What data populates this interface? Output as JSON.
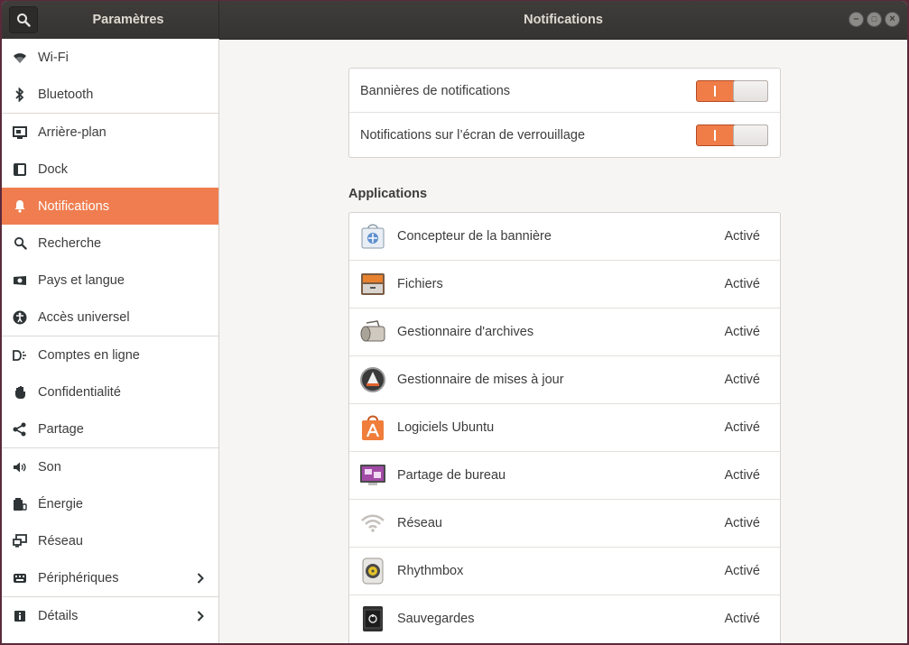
{
  "header": {
    "sidebar_title": "Paramètres",
    "title": "Notifications",
    "search_icon": "search-icon",
    "window_buttons": [
      "minimize",
      "maximize",
      "close"
    ]
  },
  "sidebar": {
    "items": [
      {
        "label": "Wi-Fi",
        "icon": "wifi-icon"
      },
      {
        "label": "Bluetooth",
        "icon": "bluetooth-icon"
      },
      {
        "label": "Arrière-plan",
        "icon": "background-icon"
      },
      {
        "label": "Dock",
        "icon": "dock-icon"
      },
      {
        "label": "Notifications",
        "icon": "bell-icon",
        "active": true
      },
      {
        "label": "Recherche",
        "icon": "search-icon"
      },
      {
        "label": "Pays et langue",
        "icon": "region-icon"
      },
      {
        "label": "Accès universel",
        "icon": "accessibility-icon"
      },
      {
        "label": "Comptes en ligne",
        "icon": "online-accounts-icon"
      },
      {
        "label": "Confidentialité",
        "icon": "privacy-hand-icon"
      },
      {
        "label": "Partage",
        "icon": "share-icon"
      },
      {
        "label": "Son",
        "icon": "speaker-icon"
      },
      {
        "label": "Énergie",
        "icon": "power-icon"
      },
      {
        "label": "Réseau",
        "icon": "network-icon"
      },
      {
        "label": "Périphériques",
        "icon": "devices-icon",
        "chevron": true
      },
      {
        "label": "Détails",
        "icon": "info-icon",
        "chevron": true
      }
    ]
  },
  "toggles": [
    {
      "label": "Bannières de notifications",
      "on": true
    },
    {
      "label": "Notifications sur l’écran de verrouillage",
      "on": true
    }
  ],
  "applications": {
    "title": "Applications",
    "items": [
      {
        "name": "Concepteur de la bannière",
        "status": "Activé",
        "icon": "banner-designer-icon"
      },
      {
        "name": "Fichiers",
        "status": "Activé",
        "icon": "files-cabinet-icon"
      },
      {
        "name": "Gestionnaire d'archives",
        "status": "Activé",
        "icon": "archive-manager-icon"
      },
      {
        "name": "Gestionnaire de mises à jour",
        "status": "Activé",
        "icon": "update-manager-icon"
      },
      {
        "name": "Logiciels Ubuntu",
        "status": "Activé",
        "icon": "ubuntu-software-bag-icon"
      },
      {
        "name": "Partage de bureau",
        "status": "Activé",
        "icon": "desktop-sharing-icon"
      },
      {
        "name": "Réseau",
        "status": "Activé",
        "icon": "network-wifi-icon"
      },
      {
        "name": "Rhythmbox",
        "status": "Activé",
        "icon": "rhythmbox-speaker-icon"
      },
      {
        "name": "Sauvegardes",
        "status": "Activé",
        "icon": "backup-safe-icon"
      }
    ]
  },
  "colors": {
    "accent": "#ef7d4f",
    "headerbar": "#3c3b37",
    "border": "#d6d1cd"
  }
}
